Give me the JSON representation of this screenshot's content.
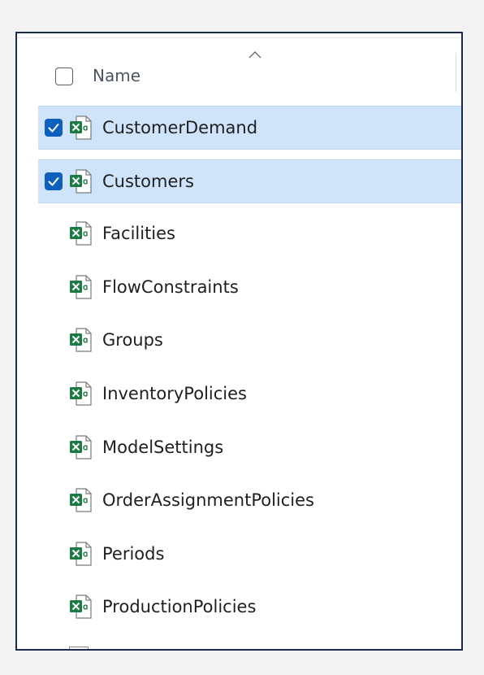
{
  "header": {
    "name_label": "Name"
  },
  "files": [
    {
      "name": "CustomerDemand",
      "selected": true,
      "icon": "excel-file-icon"
    },
    {
      "name": "Customers",
      "selected": true,
      "icon": "excel-file-icon"
    },
    {
      "name": "Facilities",
      "selected": false,
      "icon": "excel-file-icon"
    },
    {
      "name": "FlowConstraints",
      "selected": false,
      "icon": "excel-file-icon"
    },
    {
      "name": "Groups",
      "selected": false,
      "icon": "excel-file-icon"
    },
    {
      "name": "InventoryPolicies",
      "selected": false,
      "icon": "excel-file-icon"
    },
    {
      "name": "ModelSettings",
      "selected": false,
      "icon": "excel-file-icon"
    },
    {
      "name": "OrderAssignmentPolicies",
      "selected": false,
      "icon": "excel-file-icon"
    },
    {
      "name": "Periods",
      "selected": false,
      "icon": "excel-file-icon"
    },
    {
      "name": "ProductionPolicies",
      "selected": false,
      "icon": "excel-file-icon"
    }
  ],
  "colors": {
    "selection_bg": "#cfe4fa",
    "checkbox_checked": "#0f5fbf",
    "excel_green": "#1e7a45",
    "frame_border": "#1a2a4f"
  }
}
